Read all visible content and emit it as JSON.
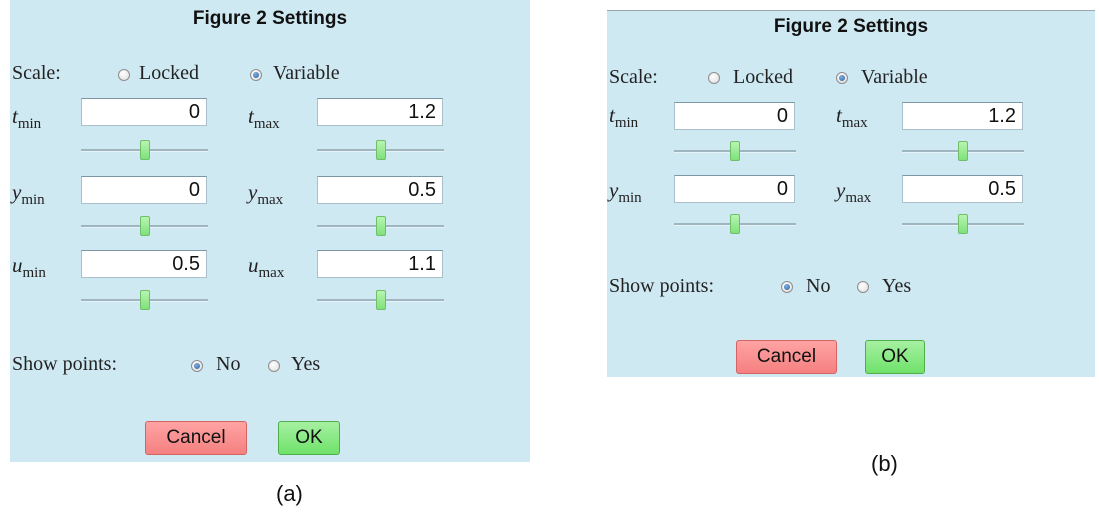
{
  "panel_a": {
    "title": "Figure 2 Settings",
    "scale": {
      "label": "Scale:",
      "locked": "Locked",
      "variable": "Variable",
      "selected": "Variable"
    },
    "t_min": {
      "var": "t",
      "sub": "min",
      "value": "0",
      "slider": 0.5
    },
    "t_max": {
      "var": "t",
      "sub": "max",
      "value": "1.2",
      "slider": 0.5
    },
    "y_min": {
      "var": "y",
      "sub": "min",
      "value": "0",
      "slider": 0.5
    },
    "y_max": {
      "var": "y",
      "sub": "max",
      "value": "0.5",
      "slider": 0.5
    },
    "u_min": {
      "var": "u",
      "sub": "min",
      "value": "0.5",
      "slider": 0.5
    },
    "u_max": {
      "var": "u",
      "sub": "max",
      "value": "1.1",
      "slider": 0.5
    },
    "show_points": {
      "label": "Show points:",
      "no": "No",
      "yes": "Yes",
      "selected": "No"
    },
    "cancel": "Cancel",
    "ok": "OK",
    "caption": "(a)"
  },
  "panel_b": {
    "title": "Figure 2 Settings",
    "scale": {
      "label": "Scale:",
      "locked": "Locked",
      "variable": "Variable",
      "selected": "Variable"
    },
    "t_min": {
      "var": "t",
      "sub": "min",
      "value": "0",
      "slider": 0.5
    },
    "t_max": {
      "var": "t",
      "sub": "max",
      "value": "1.2",
      "slider": 0.5
    },
    "y_min": {
      "var": "y",
      "sub": "min",
      "value": "0",
      "slider": 0.5
    },
    "y_max": {
      "var": "y",
      "sub": "max",
      "value": "0.5",
      "slider": 0.5
    },
    "show_points": {
      "label": "Show points:",
      "no": "No",
      "yes": "Yes",
      "selected": "No"
    },
    "cancel": "Cancel",
    "ok": "OK",
    "caption": "(b)"
  },
  "colors": {
    "panel_bg": "#cfe9f3",
    "cancel_bg": "#f58080",
    "ok_bg": "#6fe26a",
    "slider_thumb": "#7fe17a"
  }
}
